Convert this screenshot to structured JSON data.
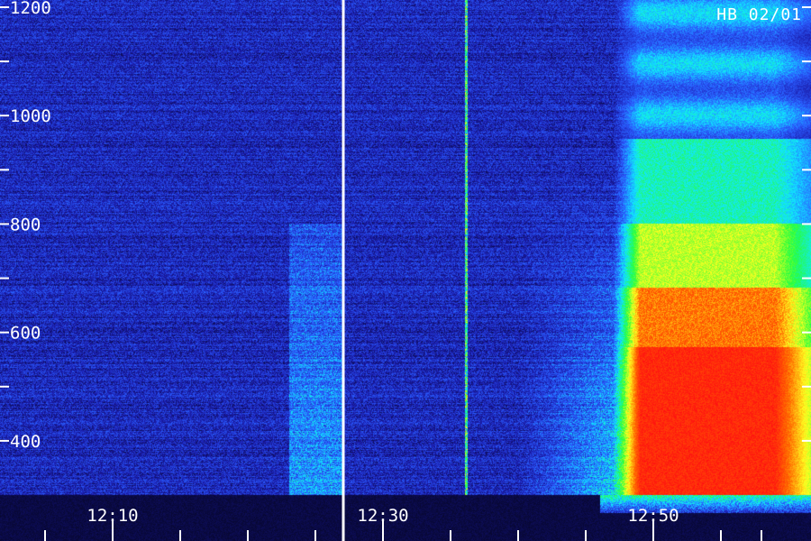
{
  "station_label": "HB 02/01",
  "chart_data": {
    "type": "heatmap",
    "title": "",
    "xlabel": "",
    "ylabel": "",
    "x_time_range": [
      "12:00",
      "12:59"
    ],
    "ylim": [
      300,
      1200
    ],
    "y_major_ticks": [
      400,
      600,
      800,
      1000,
      1200
    ],
    "y_minor_ticks": [
      500,
      700,
      900,
      1100
    ],
    "x_labels": [
      "12:10",
      "12:30",
      "12:50"
    ],
    "x_minor_tick_minutes": [
      5,
      15,
      20,
      25,
      35,
      40,
      45,
      55,
      58
    ],
    "x_major_tick_minutes": [
      10,
      30,
      50
    ],
    "divider_time": "12:27",
    "grid": false,
    "legend": "none",
    "colormap": [
      "#04041e",
      "#1a1aa8",
      "#2a5cff",
      "#10e8ff",
      "#28ff3c",
      "#ffff20",
      "#ff6a00",
      "#ff1010"
    ],
    "intensity_features": [
      {
        "name": "background noise",
        "time_start": "12:00",
        "time_end": "12:53",
        "freq_min": 300,
        "freq_max": 1200,
        "level": 0.12
      },
      {
        "name": "weak band",
        "time_start": "12:23",
        "time_end": "12:27",
        "freq_min": 300,
        "freq_max": 900,
        "level": 0.22
      },
      {
        "name": "rising emission",
        "time_start": "12:40",
        "time_end": "12:49",
        "freq_min": 300,
        "freq_max": 800,
        "level": 0.3
      },
      {
        "name": "strong emission",
        "time_start": "12:48",
        "time_end": "12:59",
        "freq_min": 300,
        "freq_max": 1200,
        "level": 1.0
      },
      {
        "name": "narrow line",
        "time_start": "12:36",
        "time_end": "12:36",
        "freq_min": 300,
        "freq_max": 1200,
        "level": 0.55
      }
    ]
  }
}
